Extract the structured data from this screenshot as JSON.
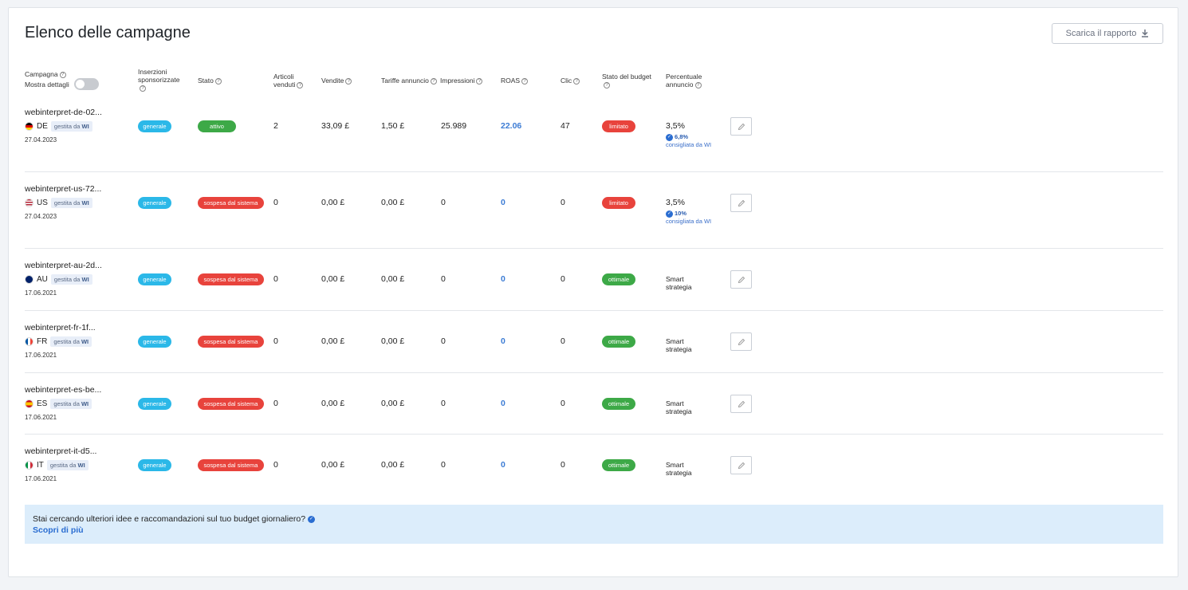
{
  "page": {
    "title": "Elenco delle campagne",
    "download_label": "Scarica il rapporto"
  },
  "headers": {
    "campagna": "Campagna",
    "mostra_dettagli": "Mostra dettagli",
    "inserzioni_1": "Inserzioni",
    "inserzioni_2": "sponsorizzate",
    "stato": "Stato",
    "articoli_1": "Articoli",
    "articoli_2": "venduti",
    "vendite": "Vendite",
    "tariffe": "Tariffe annuncio",
    "impressioni": "Impressioni",
    "roas": "ROAS",
    "clic": "Clic",
    "stato_budget": "Stato del budget",
    "percentuale_1": "Percentuale",
    "percentuale_2": "annuncio"
  },
  "common": {
    "managed_prefix": "gestita da",
    "managed_by": "WI",
    "recommended_label": "consigliata da WI",
    "smart_1": "Smart",
    "smart_2": "strategia"
  },
  "rows": [
    {
      "name": "webinterpret-de-02...",
      "country": "DE",
      "date": "27.04.2023",
      "inserzioni": "generale",
      "stato": "attivo",
      "articoli": "2",
      "vendite": "33,09 £",
      "tariffe": "1,50 £",
      "impressioni": "25.989",
      "roas": "22.06",
      "clic": "47",
      "budget": "limitato",
      "percentuale": "3,5%",
      "recommended": "6,8%"
    },
    {
      "name": "webinterpret-us-72...",
      "country": "US",
      "date": "27.04.2023",
      "inserzioni": "generale",
      "stato": "sospesa dal sistema",
      "articoli": "0",
      "vendite": "0,00 £",
      "tariffe": "0,00 £",
      "impressioni": "0",
      "roas": "0",
      "clic": "0",
      "budget": "limitato",
      "percentuale": "3,5%",
      "recommended": "10%"
    },
    {
      "name": "webinterpret-au-2d...",
      "country": "AU",
      "date": "17.06.2021",
      "inserzioni": "generale",
      "stato": "sospesa dal sistema",
      "articoli": "0",
      "vendite": "0,00 £",
      "tariffe": "0,00 £",
      "impressioni": "0",
      "roas": "0",
      "clic": "0",
      "budget": "ottimale"
    },
    {
      "name": "webinterpret-fr-1f...",
      "country": "FR",
      "date": "17.06.2021",
      "inserzioni": "generale",
      "stato": "sospesa dal sistema",
      "articoli": "0",
      "vendite": "0,00 £",
      "tariffe": "0,00 £",
      "impressioni": "0",
      "roas": "0",
      "clic": "0",
      "budget": "ottimale"
    },
    {
      "name": "webinterpret-es-be...",
      "country": "ES",
      "date": "17.06.2021",
      "inserzioni": "generale",
      "stato": "sospesa dal sistema",
      "articoli": "0",
      "vendite": "0,00 £",
      "tariffe": "0,00 £",
      "impressioni": "0",
      "roas": "0",
      "clic": "0",
      "budget": "ottimale"
    },
    {
      "name": "webinterpret-it-d5...",
      "country": "IT",
      "date": "17.06.2021",
      "inserzioni": "generale",
      "stato": "sospesa dal sistema",
      "articoli": "0",
      "vendite": "0,00 £",
      "tariffe": "0,00 £",
      "impressioni": "0",
      "roas": "0",
      "clic": "0",
      "budget": "ottimale"
    }
  ],
  "banner": {
    "message": "Stai cercando ulteriori idee e raccomandazioni sul tuo budget giornaliero?",
    "link": "Scopri di più"
  },
  "colors": {
    "active": "#3da947",
    "suspended": "#e8433c",
    "general": "#2bb8e8",
    "link": "#2a6dd1"
  }
}
